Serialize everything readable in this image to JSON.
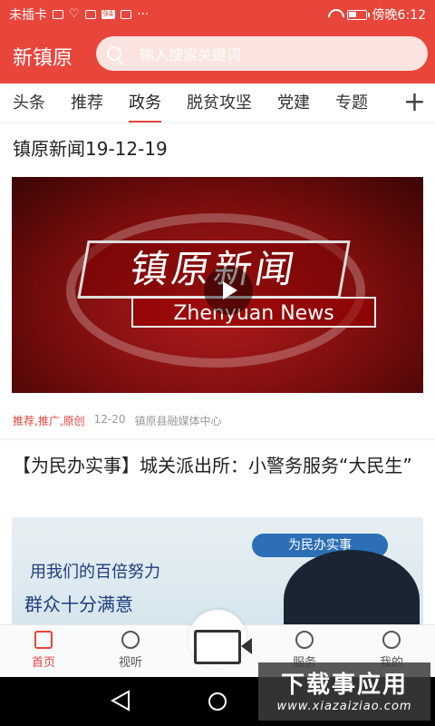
{
  "status_bar": {
    "carrier": "未插卡",
    "badge": "94",
    "more": "···",
    "time": "傍晚6:12"
  },
  "header": {
    "app_name": "新镇原",
    "search_placeholder": "输入搜索关键词"
  },
  "tabs": [
    {
      "label": "头条",
      "active": false
    },
    {
      "label": "推荐",
      "active": false
    },
    {
      "label": "政务",
      "active": true
    },
    {
      "label": "脱贫攻坚",
      "active": false
    },
    {
      "label": "党建",
      "active": false
    },
    {
      "label": "专题",
      "active": false
    }
  ],
  "tabs_more_label": "+",
  "articles": [
    {
      "title": "镇原新闻19-12-19",
      "thumb_text_cn": "镇原新闻",
      "thumb_text_en": "Zhenyuan News",
      "tags": "推荐,推广,原创",
      "date": "12-20",
      "source": "镇原县融媒体中心"
    },
    {
      "title": "【为民办实事】城关派出所：小警务服务“大民生”",
      "thumb_banner": "为民办实事",
      "thumb_text1": "用我们的百倍努力",
      "thumb_text2": "群众十分满意"
    }
  ],
  "bottom_nav": [
    {
      "label": "首页",
      "icon": "home-icon",
      "active": true
    },
    {
      "label": "视听",
      "icon": "play-circle-icon",
      "active": false
    },
    {
      "label": "服务",
      "icon": "heart-icon",
      "active": false
    },
    {
      "label": "我的",
      "icon": "user-icon",
      "active": false
    }
  ],
  "watermark": {
    "line1": "下载事应用",
    "line2": "www.xiazaiziao.com"
  },
  "colors": {
    "accent": "#e8453b"
  }
}
